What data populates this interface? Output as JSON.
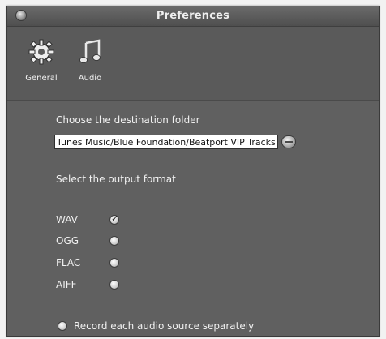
{
  "window": {
    "title": "Preferences"
  },
  "toolbar": {
    "items": [
      {
        "label": "General",
        "icon": "gear-icon"
      },
      {
        "label": "Audio",
        "icon": "music-note-icon"
      }
    ]
  },
  "destination": {
    "label": "Choose the destination folder",
    "path": "Tunes Music/Blue Foundation/Beatport VIP Tracks"
  },
  "output_format": {
    "label": "Select the output format",
    "options": [
      {
        "label": "WAV",
        "selected": true
      },
      {
        "label": "OGG",
        "selected": false
      },
      {
        "label": "FLAC",
        "selected": false
      },
      {
        "label": "AIFF",
        "selected": false
      }
    ]
  },
  "record_separately": {
    "label": "Record each audio source separately",
    "checked": false
  }
}
